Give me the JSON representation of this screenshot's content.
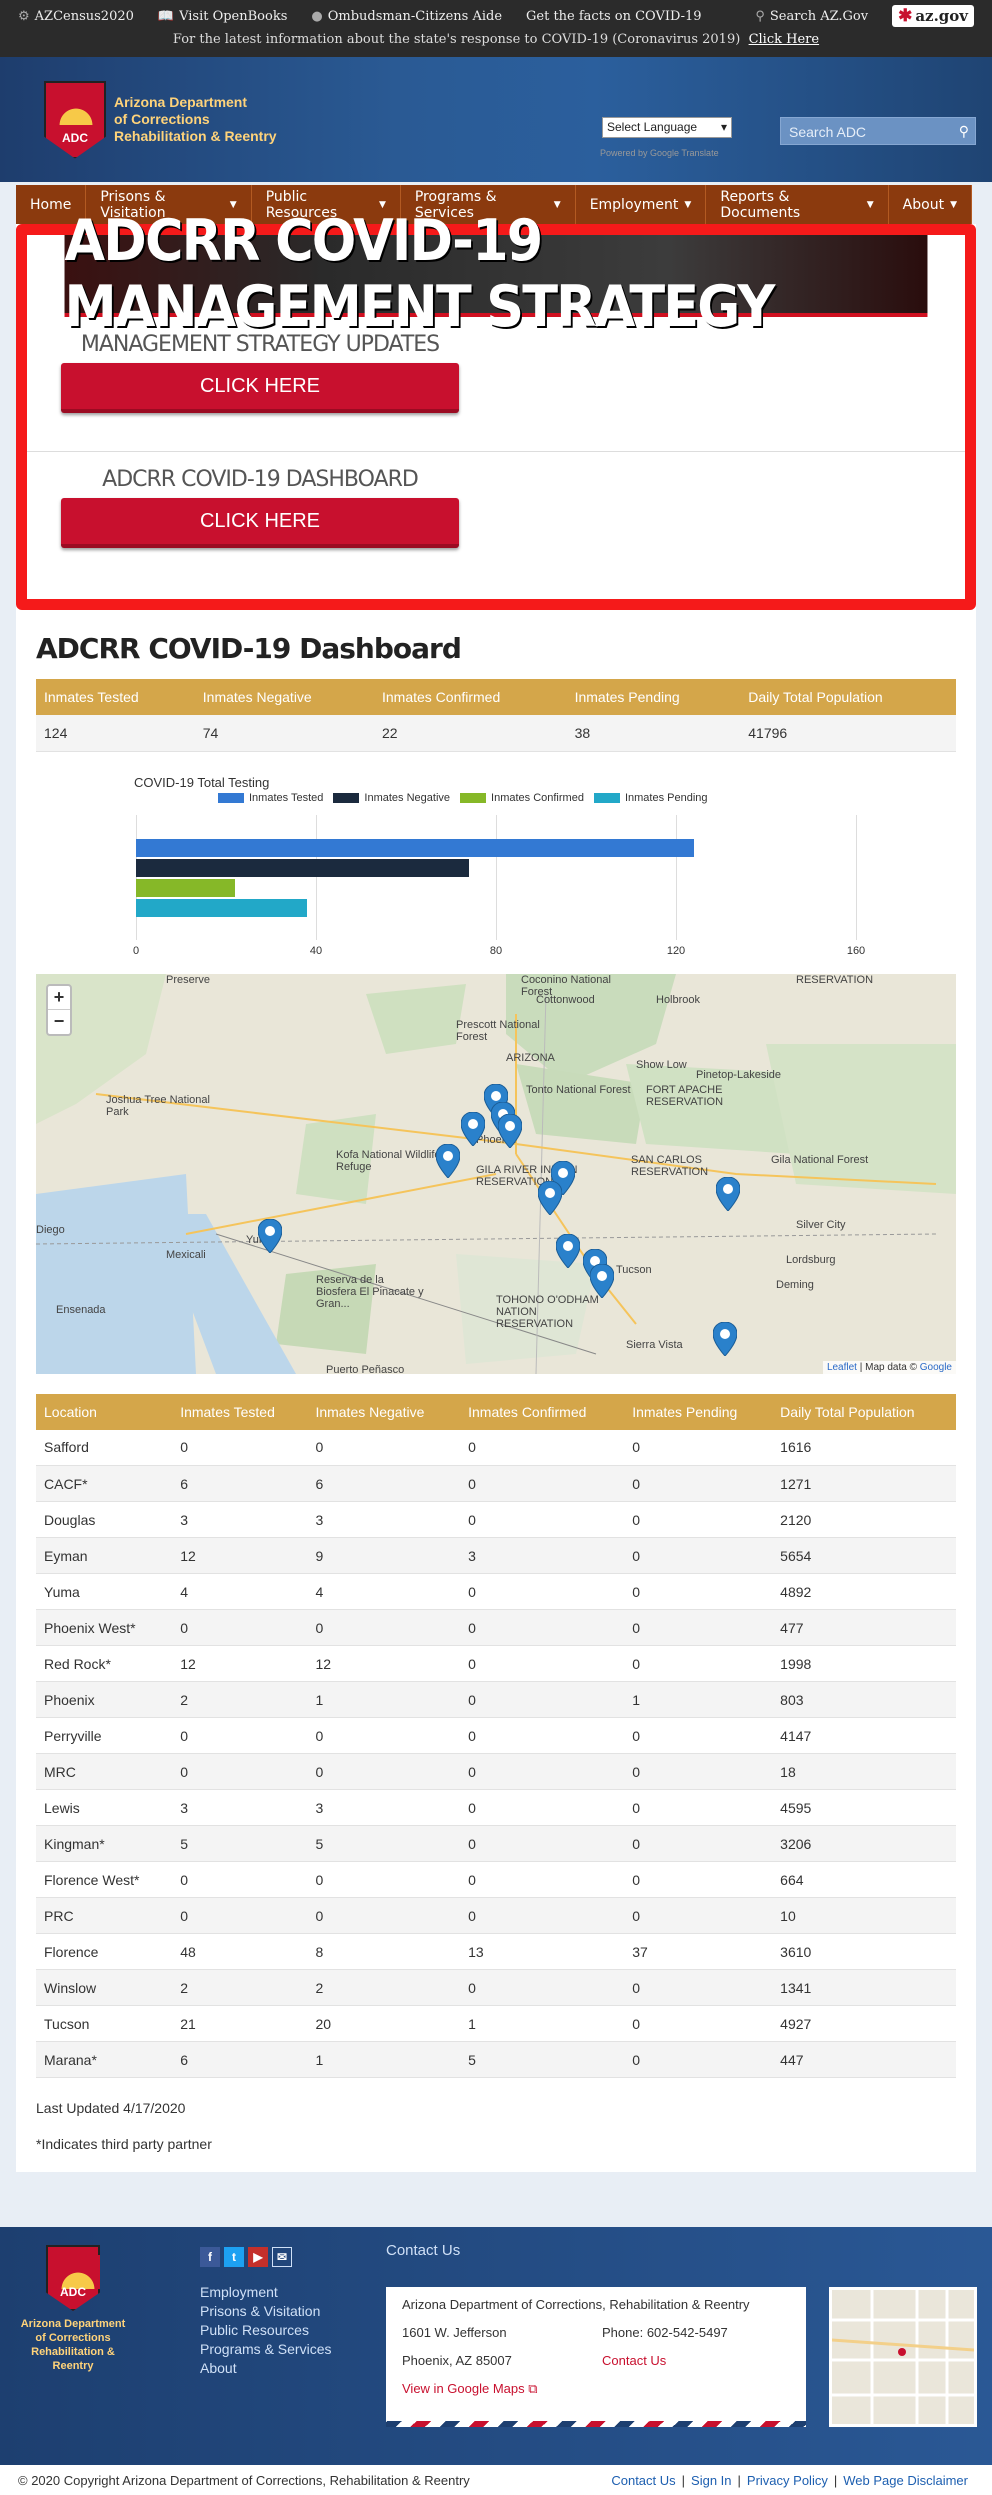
{
  "topbar": {
    "census": "AZCensus2020",
    "openbooks": "Visit OpenBooks",
    "ombudsman": "Ombudsman-Citizens Aide",
    "covid_facts": "Get the facts on COVID-19",
    "search_az": "Search AZ.Gov",
    "azgov": "az.gov",
    "notice": "For the latest information about the state's response to COVID-19 (Coronavirus 2019)",
    "notice_link": "Click Here"
  },
  "header": {
    "logo_line1": "Arizona Department",
    "logo_line2": "of Corrections",
    "logo_line3": "Rehabilitation & Reentry",
    "badge_text": "ADC",
    "language": "Select Language",
    "powered": "Powered by Google Translate",
    "search_placeholder": "Search ADC"
  },
  "nav": [
    "Home",
    "Prisons & Visitation",
    "Public Resources",
    "Programs & Services",
    "Employment",
    "Reports & Documents",
    "About"
  ],
  "covid": {
    "banner": "ADCRR COVID-19 MANAGEMENT STRATEGY",
    "updates_title": "MANAGEMENT STRATEGY UPDATES",
    "dashboard_title": "ADCRR COVID-19 DASHBOARD",
    "click_here": "CLICK HERE"
  },
  "dashboard": {
    "title": "ADCRR COVID-19 Dashboard",
    "summary_headers": [
      "Inmates Tested",
      "Inmates Negative",
      "Inmates Confirmed",
      "Inmates Pending",
      "Daily Total Population"
    ],
    "summary_values": [
      "124",
      "74",
      "22",
      "38",
      "41796"
    ]
  },
  "chart_data": {
    "type": "bar",
    "title": "COVID-19 Total Testing",
    "series": [
      {
        "name": "Inmates Tested",
        "value": 124,
        "color": "#3379d3"
      },
      {
        "name": "Inmates Negative",
        "value": 74,
        "color": "#1b2a3e"
      },
      {
        "name": "Inmates Confirmed",
        "value": 22,
        "color": "#86b828"
      },
      {
        "name": "Inmates Pending",
        "value": 38,
        "color": "#22a8c8"
      }
    ],
    "xticks": [
      "0",
      "40",
      "80",
      "120",
      "160"
    ],
    "xlim": [
      0,
      160
    ]
  },
  "map": {
    "zoom_in": "+",
    "zoom_out": "−",
    "labels": [
      "Preserve",
      "Coconino National Forest",
      "Cottonwood",
      "Prescott National Forest",
      "ARIZONA",
      "Tonto National Forest",
      "Show Low",
      "Pinetop-Lakeside",
      "FORT APACHE RESERVATION",
      "Joshua Tree National Park",
      "Phoenix",
      "Kofa National Wildlife Refuge",
      "GILA RIVER INDIAN RESERVATION",
      "SAN CARLOS RESERVATION",
      "Gila National Forest",
      "Diego",
      "Mexicali",
      "Yuma",
      "Reserva de la Biosfera El Pinacate y Gran...",
      "TOHONO O'ODHAM NATION RESERVATION",
      "Tucson",
      "Silver City",
      "Lordsburg",
      "Deming",
      "Sierra Vista",
      "Ensenada",
      "Puerto Peñasco",
      "Holbrook",
      "RESERVATION"
    ],
    "attribution_leaflet": "Leaflet",
    "attribution_rest": " | Map data © ",
    "attribution_google": "Google"
  },
  "locations": {
    "headers": [
      "Location",
      "Inmates Tested",
      "Inmates Negative",
      "Inmates Confirmed",
      "Inmates Pending",
      "Daily Total Population"
    ],
    "rows": [
      [
        "Safford",
        "0",
        "0",
        "0",
        "0",
        "1616"
      ],
      [
        "CACF*",
        "6",
        "6",
        "0",
        "0",
        "1271"
      ],
      [
        "Douglas",
        "3",
        "3",
        "0",
        "0",
        "2120"
      ],
      [
        "Eyman",
        "12",
        "9",
        "3",
        "0",
        "5654"
      ],
      [
        "Yuma",
        "4",
        "4",
        "0",
        "0",
        "4892"
      ],
      [
        "Phoenix West*",
        "0",
        "0",
        "0",
        "0",
        "477"
      ],
      [
        "Red Rock*",
        "12",
        "12",
        "0",
        "0",
        "1998"
      ],
      [
        "Phoenix",
        "2",
        "1",
        "0",
        "1",
        "803"
      ],
      [
        "Perryville",
        "0",
        "0",
        "0",
        "0",
        "4147"
      ],
      [
        "MRC",
        "0",
        "0",
        "0",
        "0",
        "18"
      ],
      [
        "Lewis",
        "3",
        "3",
        "0",
        "0",
        "4595"
      ],
      [
        "Kingman*",
        "5",
        "5",
        "0",
        "0",
        "3206"
      ],
      [
        "Florence West*",
        "0",
        "0",
        "0",
        "0",
        "664"
      ],
      [
        "PRC",
        "0",
        "0",
        "0",
        "0",
        "10"
      ],
      [
        "Florence",
        "48",
        "8",
        "13",
        "37",
        "3610"
      ],
      [
        "Winslow",
        "2",
        "2",
        "0",
        "0",
        "1341"
      ],
      [
        "Tucson",
        "21",
        "20",
        "1",
        "0",
        "4927"
      ],
      [
        "Marana*",
        "6",
        "1",
        "5",
        "0",
        "447"
      ]
    ]
  },
  "notes": {
    "updated": "Last Updated 4/17/2020",
    "partner": "*Indicates third party partner"
  },
  "footer": {
    "logo_text": "Arizona Department of Corrections Rehabilitation & Reentry",
    "badge_text": "ADC",
    "links": [
      "Employment",
      "Prisons & Visitation",
      "Public Resources",
      "Programs & Services",
      "About"
    ],
    "contact_heading": "Contact Us",
    "org": "Arizona Department of Corrections, Rehabilitation & Reentry",
    "street": "1601 W. Jefferson",
    "city": "Phoenix, AZ 85007",
    "phone": "Phone: 602-542-5497",
    "contact_link": "Contact Us",
    "maps_link": "View in Google Maps"
  },
  "copyright": {
    "text": "© 2020 Copyright Arizona Department of Corrections, Rehabilitation & Reentry",
    "links": [
      "Contact Us",
      "Sign In",
      "Privacy Policy",
      "Web Page Disclaimer"
    ]
  }
}
